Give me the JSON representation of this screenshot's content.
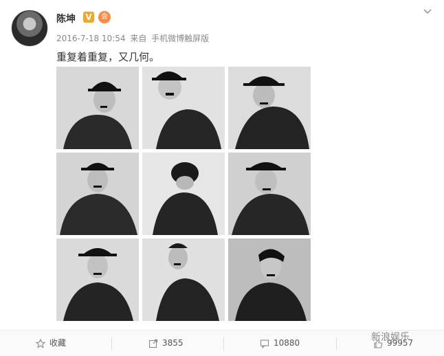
{
  "post": {
    "username": "陈坤",
    "verified_badge": "V",
    "member_badge": "会",
    "date": "2016-7-18 10:54",
    "source_prefix": "来自",
    "source": "手机微博触屏版",
    "text": "重复着重复，又几何。",
    "images": [
      {
        "label": "photo-1"
      },
      {
        "label": "photo-2"
      },
      {
        "label": "photo-3"
      },
      {
        "label": "photo-4"
      },
      {
        "label": "photo-5"
      },
      {
        "label": "photo-6"
      },
      {
        "label": "photo-7"
      },
      {
        "label": "photo-8"
      },
      {
        "label": "photo-9"
      }
    ]
  },
  "actions": {
    "favorite_label": "收藏",
    "repost_count": "3855",
    "comment_count": "10880",
    "like_count": "99957"
  },
  "watermark": "新浪娱乐",
  "icons": {
    "verified": "verified-v-icon",
    "member": "member-crown-icon",
    "more": "chevron-down-icon",
    "favorite": "star-icon",
    "repost": "repost-icon",
    "comment": "comment-icon",
    "like": "thumbs-up-icon"
  },
  "colors": {
    "verified": "#f6a623",
    "member": "#ff8a3d"
  }
}
